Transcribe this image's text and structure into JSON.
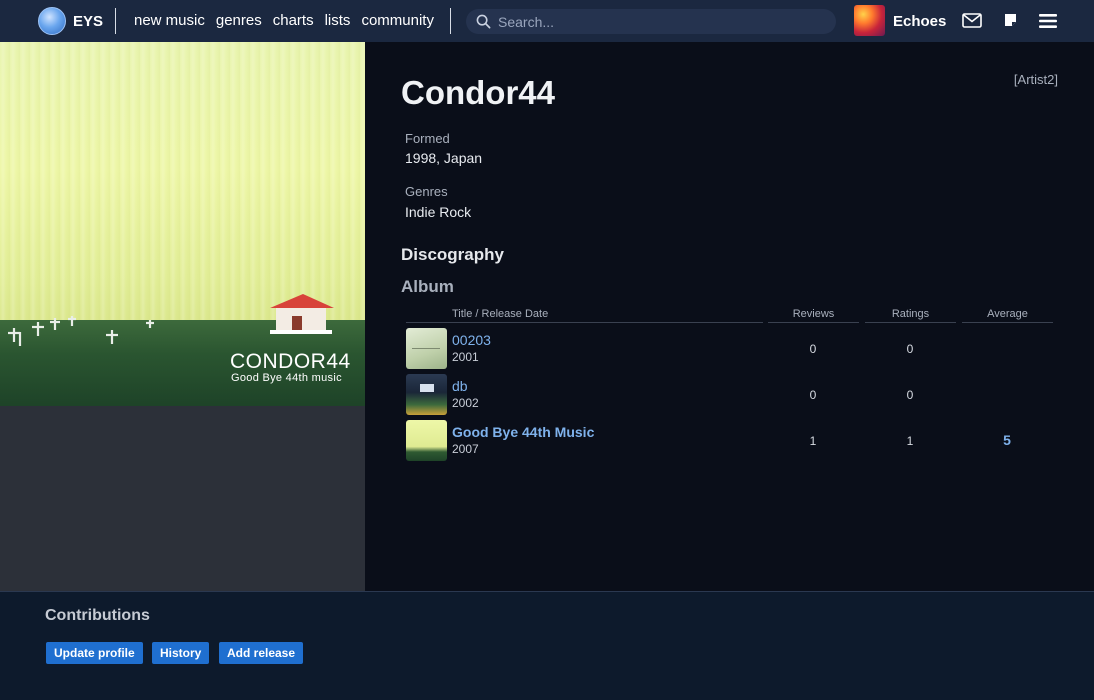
{
  "header": {
    "brand": "EYS",
    "nav": [
      "new music",
      "genres",
      "charts",
      "lists",
      "community"
    ],
    "search_placeholder": "Search...",
    "user_name": "Echoes"
  },
  "cover": {
    "title": "CONDOR44",
    "subtitle": "Good Bye 44th music"
  },
  "artist": {
    "name": "Condor44",
    "tag": "[Artist2]",
    "formed_label": "Formed",
    "formed_value": "1998, Japan",
    "genres_label": "Genres",
    "genres_value": "Indie Rock"
  },
  "discography": {
    "heading": "Discography",
    "section": "Album",
    "columns": [
      "Title / Release Date",
      "Reviews",
      "Ratings",
      "Average"
    ],
    "releases": [
      {
        "title": "00203",
        "year": "2001",
        "reviews": "0",
        "ratings": "0",
        "average": ""
      },
      {
        "title": "db",
        "year": "2002",
        "reviews": "0",
        "ratings": "0",
        "average": ""
      },
      {
        "title": "Good Bye 44th Music",
        "year": "2007",
        "reviews": "1",
        "ratings": "1",
        "average": "5"
      }
    ]
  },
  "contributions": {
    "heading": "Contributions",
    "buttons": [
      "Update profile",
      "History",
      "Add release"
    ]
  },
  "colors": {
    "accent": "#1f6fd0",
    "link": "#7fb2ec",
    "topbar": "#1b2840"
  }
}
